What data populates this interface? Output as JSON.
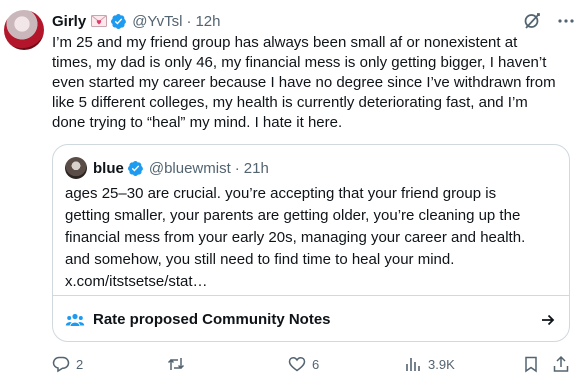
{
  "tweet": {
    "display_name": "Girly",
    "handle": "@YvTsl",
    "separator": "·",
    "time": "12h",
    "text": "I’m 25 and my friend group has always been small af or nonexistent at\ntimes, my dad is only 46, my financial mess is only getting bigger, I haven’t\neven started my career because I have no degree since I’ve withdrawn from\nlike 5 different colleges, my health is currently deteriorating fast, and I’m\ndone trying to “heal” my mind. I hate it here."
  },
  "quote": {
    "display_name": "blue",
    "handle": "@bluewmist",
    "separator": "·",
    "time": "21h",
    "text": "ages 25–30 are crucial. you’re accepting that your friend group is\ngetting smaller, your parents are getting older, you’re cleaning up the\nfinancial mess from your early 20s, managing your career and health.\nand somehow, you still need to find time to heal your mind.\nx.com/itstsetse/stat…",
    "community_notes_label": "Rate proposed Community Notes"
  },
  "actions": {
    "replies": "2",
    "retweets": "",
    "likes": "6",
    "views": "3.9K"
  },
  "colors": {
    "text_primary": "#0f1419",
    "text_secondary": "#536471",
    "verified": "#1d9bf0",
    "border": "#cfd9de"
  },
  "icons": [
    "verified-badge-icon",
    "heart-letter-emoji-icon",
    "grok-icon",
    "more-icon",
    "community-notes-people-icon",
    "arrow-right-icon",
    "reply-icon",
    "retweet-icon",
    "like-icon",
    "views-icon",
    "bookmark-icon",
    "share-icon"
  ]
}
